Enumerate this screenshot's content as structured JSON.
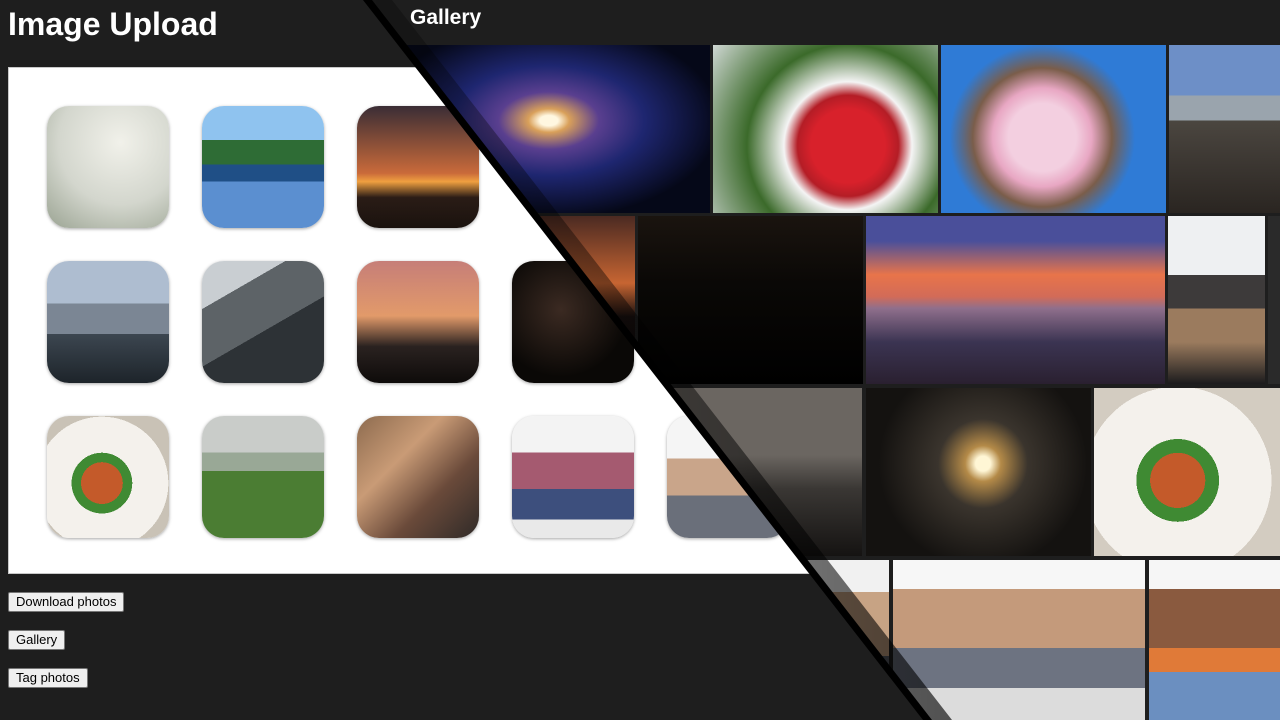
{
  "upload": {
    "title": "Image Upload",
    "thumbnails": [
      {
        "icon": "photo-bare-tree"
      },
      {
        "icon": "photo-forest-lake"
      },
      {
        "icon": "photo-padlock-sunset"
      },
      {
        "icon": "photo-city-skyline"
      },
      {
        "icon": "photo-skyscrapers"
      },
      {
        "icon": "photo-dusk-silhouette"
      },
      {
        "icon": "photo-night-street"
      },
      {
        "icon": "photo-plated-food"
      },
      {
        "icon": "photo-foggy-field"
      },
      {
        "icon": "photo-friends-tablet"
      },
      {
        "icon": "photo-crowd"
      },
      {
        "icon": "photo-group-thumbs-up"
      }
    ],
    "buttons": {
      "download": "Download photos",
      "gallery": "Gallery",
      "tag": "Tag photos"
    }
  },
  "gallery": {
    "title": "Gallery",
    "tiles": [
      {
        "icon": "galaxy-photo"
      },
      {
        "icon": "snow-berries-photo"
      },
      {
        "icon": "blossom-photo"
      },
      {
        "icon": "city-sky-photo"
      },
      {
        "icon": "dusk-photo"
      },
      {
        "icon": "night-cranes-photo"
      },
      {
        "icon": "sunset-pier-photo"
      },
      {
        "icon": "dog-crate-photo"
      },
      {
        "icon": "fog-photo"
      },
      {
        "icon": "moon-lake-photo"
      },
      {
        "icon": "plated-food-photo"
      },
      {
        "icon": "people-partial-photo"
      },
      {
        "icon": "group-thumbs-up-photo"
      },
      {
        "icon": "smiling-people-photo"
      }
    ]
  },
  "colors": {
    "background": "#1e1e1e",
    "panel": "#ffffff",
    "text": "#ffffff",
    "button_bg": "#efefef"
  }
}
